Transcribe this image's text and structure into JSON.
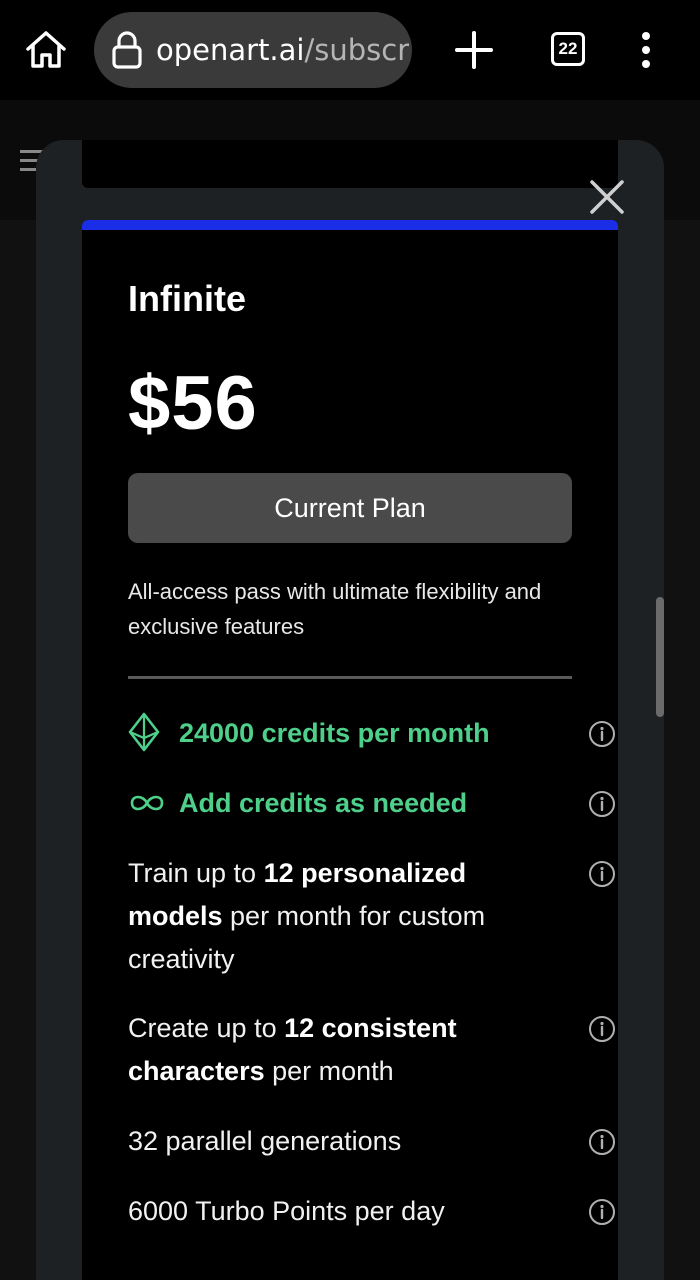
{
  "browser": {
    "url_domain": "openart.ai",
    "url_path": "/subscr",
    "tab_count": "22",
    "icons": [
      "home-icon",
      "lock-icon",
      "plus-icon",
      "tabs-icon",
      "more-vertical-icon"
    ]
  },
  "plan": {
    "name": "Infinite",
    "price": "$56",
    "button_label": "Current Plan",
    "description": "All-access pass with ultimate flexibility and exclusive features",
    "accent_color": "#1a2ee8",
    "features": [
      {
        "pre": "",
        "bold": "",
        "post": "24000 credits per month",
        "icon": "diamond-icon",
        "style": "green"
      },
      {
        "pre": "",
        "bold": "",
        "post": "Add credits as needed",
        "icon": "infinity-icon",
        "style": "green"
      },
      {
        "pre": "Train up to ",
        "bold": "12 personalized models",
        "post": " per month for custom creativity",
        "icon": "",
        "style": "normal"
      },
      {
        "pre": "Create up to ",
        "bold": "12 consistent characters",
        "post": " per month",
        "icon": "",
        "style": "normal"
      },
      {
        "pre": "",
        "bold": "",
        "post": "32 parallel generations",
        "icon": "",
        "style": "normal"
      },
      {
        "pre": "",
        "bold": "",
        "post": "6000 Turbo Points per day",
        "icon": "",
        "style": "normal"
      }
    ],
    "green_color": "#4ed08a"
  }
}
